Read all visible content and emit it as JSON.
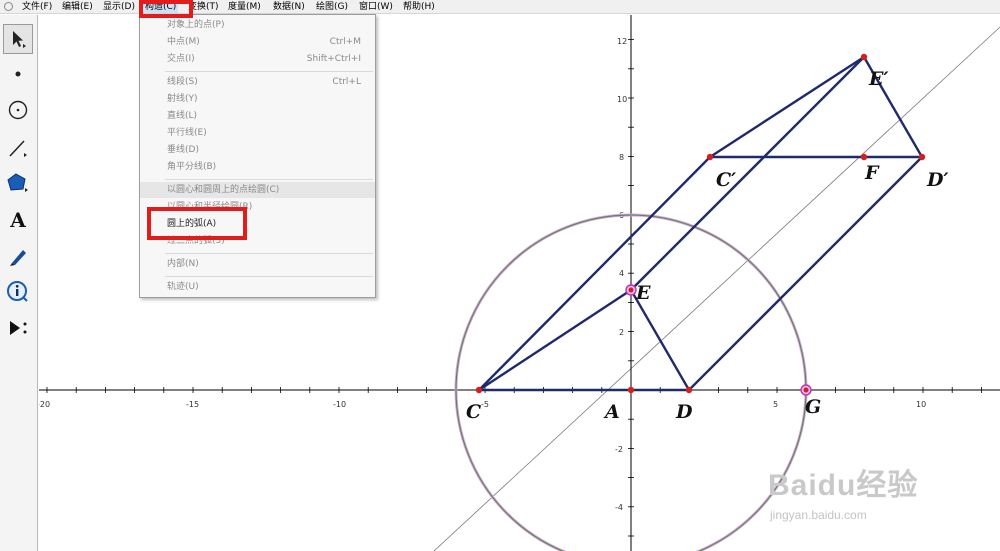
{
  "menubar": {
    "items": [
      "文件(F)",
      "编辑(E)",
      "显示(D)",
      "构造(C)",
      "变换(T)",
      "度量(M)",
      "数据(N)",
      "绘图(G)",
      "窗口(W)",
      "帮助(H)"
    ],
    "active": "构造(C)"
  },
  "toolbar": {
    "tools": [
      "arrow-select-icon",
      "point-icon",
      "compass-icon",
      "straightedge-icon",
      "polygon-icon",
      "text-icon",
      "marker-pen-icon",
      "information-icon",
      "custom-tool-icon"
    ],
    "text_tool_glyph": "A"
  },
  "construct_menu": {
    "items": [
      {
        "label": "对象上的点(P)",
        "shortcut": "",
        "enabled": false
      },
      {
        "label": "中点(M)",
        "shortcut": "Ctrl+M",
        "enabled": false
      },
      {
        "label": "交点(I)",
        "shortcut": "Shift+Ctrl+I",
        "enabled": false
      },
      {
        "label": "线段(S)",
        "shortcut": "Ctrl+L",
        "enabled": false
      },
      {
        "label": "射线(Y)",
        "shortcut": "",
        "enabled": false
      },
      {
        "label": "直线(L)",
        "shortcut": "",
        "enabled": false
      },
      {
        "label": "平行线(E)",
        "shortcut": "",
        "enabled": false
      },
      {
        "label": "垂线(D)",
        "shortcut": "",
        "enabled": false
      },
      {
        "label": "角平分线(B)",
        "shortcut": "",
        "enabled": false
      },
      {
        "label": "以圆心和圆周上的点绘圆(C)",
        "shortcut": "",
        "enabled": false
      },
      {
        "label": "以圆心和半径绘圆(R)",
        "shortcut": "",
        "enabled": false
      },
      {
        "label": "圆上的弧(A)",
        "shortcut": "",
        "enabled": true
      },
      {
        "label": "过三点的弧(3)",
        "shortcut": "",
        "enabled": false
      },
      {
        "label": "内部(N)",
        "shortcut": "",
        "enabled": false
      },
      {
        "label": "轨迹(U)",
        "shortcut": "",
        "enabled": false
      }
    ]
  },
  "graph": {
    "x_ticks": [
      "-20",
      "-15",
      "-10",
      "-5",
      "5",
      "10"
    ],
    "y_ticks": [
      "12",
      "10",
      "8",
      "6",
      "4",
      "2",
      "-2",
      "-4"
    ],
    "points": [
      {
        "label": "E′",
        "x": 8,
        "y": 11.5
      },
      {
        "label": "C′",
        "x": 0,
        "y": 8
      },
      {
        "label": "F",
        "x": 8,
        "y": 8
      },
      {
        "label": "D′",
        "x": 10,
        "y": 8
      },
      {
        "label": "E",
        "x": 0,
        "y": 3.4
      },
      {
        "label": "C",
        "x": -5,
        "y": 0
      },
      {
        "label": "A",
        "x": 0,
        "y": 0
      },
      {
        "label": "D",
        "x": 2,
        "y": 0
      },
      {
        "label": "G",
        "x": 6,
        "y": 0
      }
    ],
    "circle": {
      "center": "A",
      "through": "G"
    },
    "colors": {
      "segments": "#1f2a6b",
      "points": "#d02020",
      "circle": "#5a9a5a",
      "circle_halo": "#e080e0",
      "highlight": "#e21b1b"
    }
  },
  "watermark": {
    "logo": "Baidu经验",
    "sub": "jingyan.baidu.com"
  }
}
